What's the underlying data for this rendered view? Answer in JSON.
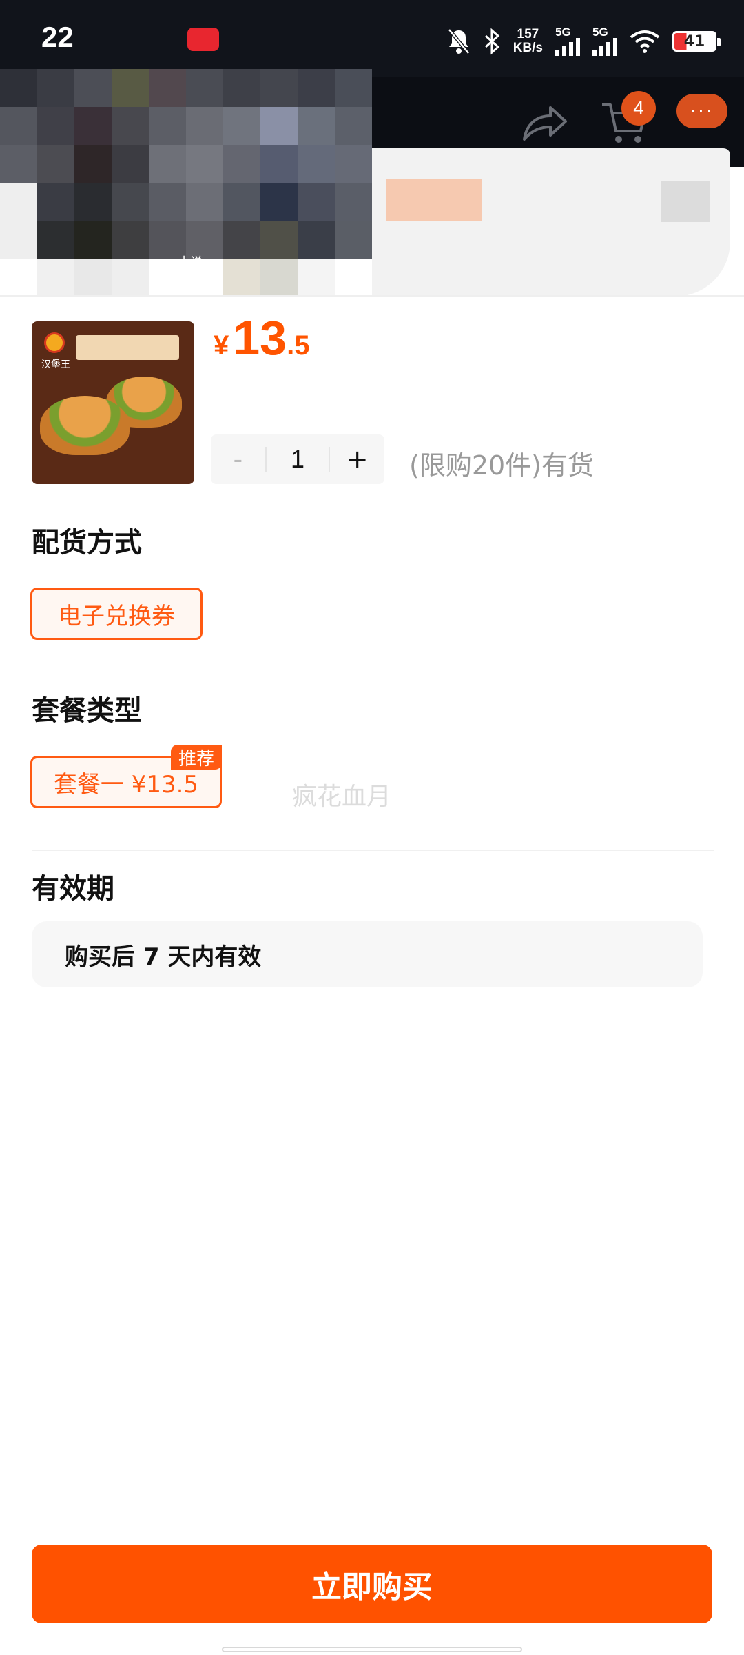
{
  "status_bar": {
    "time": "22",
    "net_speed_value": "157",
    "net_speed_unit": "KB/s",
    "sig1_label": "5G",
    "sig2_label": "5G",
    "battery": "41"
  },
  "header": {
    "cart_count": "4",
    "more_label": "···"
  },
  "obscured_video_label": "小说",
  "product": {
    "currency": "¥",
    "price_int": "13",
    "price_dec": ".5",
    "quantity": "1",
    "minus_label": "-",
    "plus_label": "+",
    "stock_text": "(限购20件)有货",
    "image_brand_text": "汉堡王"
  },
  "delivery": {
    "title": "配货方式",
    "option": "电子兑换券"
  },
  "package": {
    "title": "套餐类型",
    "option": "套餐一  ¥13.5",
    "tag": "推荐"
  },
  "watermark": "疯花血月",
  "validity": {
    "title": "有效期",
    "text": "购买后 7 天内有效"
  },
  "buy_button": "立即购买",
  "colors": {
    "accent": "#ff5200",
    "status_bar": "#11141b"
  }
}
